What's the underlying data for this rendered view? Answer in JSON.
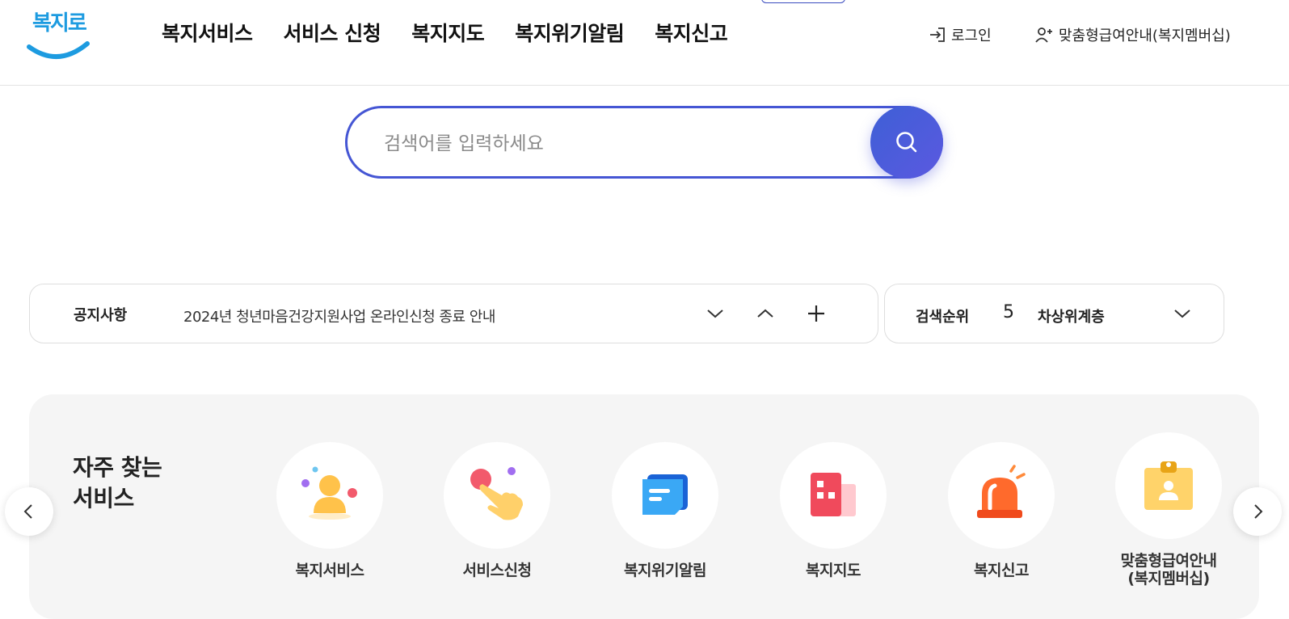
{
  "header": {
    "logo_text": "복지로",
    "nav": [
      "복지서비스",
      "서비스 신청",
      "복지지도",
      "복지위기알림",
      "복지신고"
    ],
    "login_label": "로그인",
    "membership_label": "맞춤형급여안내(복지멤버십)"
  },
  "search": {
    "placeholder": "검색어를 입력하세요",
    "value": ""
  },
  "notice": {
    "label": "공지사항",
    "text": "2024년 청년마음건강지원사업 온라인신청 종료 안내"
  },
  "ranking": {
    "label": "검색순위",
    "rank": "5",
    "term": "차상위계층"
  },
  "frequent": {
    "title_line1": "자주 찾는",
    "title_line2": "서비스",
    "items": [
      {
        "label": "복지서비스",
        "icon": "person-icon"
      },
      {
        "label": "서비스신청",
        "icon": "tap-hand-icon"
      },
      {
        "label": "복지위기알림",
        "icon": "message-icon"
      },
      {
        "label": "복지지도",
        "icon": "building-map-icon"
      },
      {
        "label": "복지신고",
        "icon": "siren-icon"
      },
      {
        "label_line1": "맞춤형급여안내",
        "label_line2": "(복지멤버십)",
        "icon": "id-badge-icon"
      }
    ]
  },
  "colors": {
    "accent": "#4556d4",
    "logo": "#1d9be0",
    "panel_bg": "#f5f5f5"
  }
}
